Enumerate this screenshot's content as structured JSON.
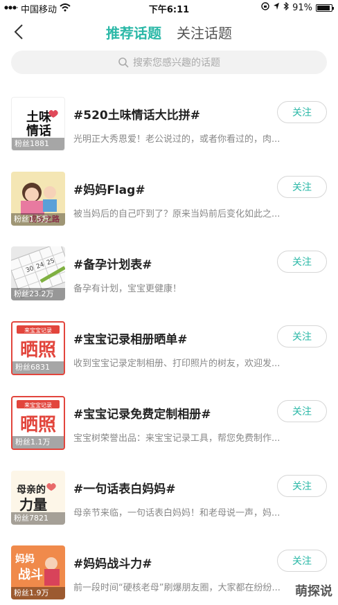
{
  "status_bar": {
    "carrier": "中国移动",
    "time": "下午6:11",
    "battery_text": "91%",
    "battery_level": 0.91
  },
  "nav": {
    "tabs": [
      {
        "label": "推荐话题",
        "active": true
      },
      {
        "label": "关注话题",
        "active": false
      }
    ]
  },
  "search": {
    "placeholder": "搜索您感兴趣的话题"
  },
  "topics": [
    {
      "title": "#520土味情话大比拼#",
      "desc": "光明正大秀恩爱！老公说过的，或者你看过的，肉...",
      "fans": "粉丝1881",
      "follow": "关注",
      "thumb_text": "土味情话",
      "thumb_colors": [
        "#ffffff",
        "#111111"
      ]
    },
    {
      "title": "#妈妈Flag#",
      "desc": "被当妈后的自己吓到了？原来当妈前后变化如此之...",
      "fans": "粉丝1.5万",
      "follow": "关注",
      "thumb_text": "成长之路",
      "thumb_colors": [
        "#f4e6b4",
        "#d24b6e"
      ]
    },
    {
      "title": "#备孕计划表#",
      "desc": "备孕有计划，宝宝更健康！",
      "fans": "粉丝23.2万",
      "follow": "关注",
      "thumb_text": "",
      "thumb_colors": [
        "#e9e9e9",
        "#555555"
      ]
    },
    {
      "title": "#宝宝记录相册晒单#",
      "desc": "收到宝宝记录定制相册、打印照片的树友，欢迎发...",
      "fans": "粉丝6831",
      "follow": "关注",
      "thumb_text": "晒照",
      "thumb_colors": [
        "#ffffff",
        "#e2453c"
      ]
    },
    {
      "title": "#宝宝记录免费定制相册#",
      "desc": "宝宝树荣誉出品：来宝宝记录工具，帮您免费制作...",
      "fans": "粉丝1.1万",
      "follow": "关注",
      "thumb_text": "晒照",
      "thumb_colors": [
        "#ffffff",
        "#e2453c"
      ]
    },
    {
      "title": "#一句话表白妈妈#",
      "desc": "母亲节来临，一句话表白妈妈！和老母说一声，妈...",
      "fans": "粉丝7821",
      "follow": "关注",
      "thumb_text": "母亲的力量",
      "thumb_colors": [
        "#fdf6e8",
        "#222222"
      ]
    },
    {
      "title": "#妈妈战斗力#",
      "desc": "前一段时间“硬核老母”刷爆朋友圈，大家都在纷纷...",
      "fans": "粉丝1.9万",
      "follow": "关注",
      "thumb_text": "妈妈战斗",
      "thumb_colors": [
        "#f08a4b",
        "#ffffff"
      ]
    }
  ],
  "watermark": "萌探说"
}
